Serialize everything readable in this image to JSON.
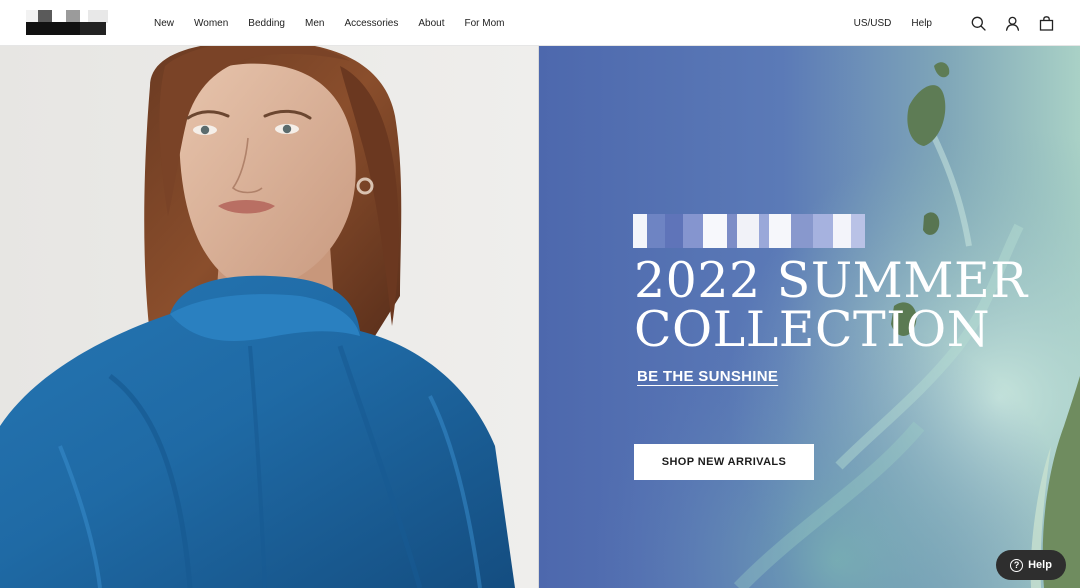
{
  "header": {
    "nav": [
      "New",
      "Women",
      "Bedding",
      "Men",
      "Accessories",
      "About",
      "For Mom"
    ],
    "region": "US/USD",
    "help": "Help",
    "icons": [
      "search-icon",
      "account-icon",
      "cart-icon"
    ]
  },
  "hero": {
    "headline_line1": "2022 SUMMER",
    "headline_line2": "COLLECTION",
    "subhead": "BE THE SUNSHINE",
    "cta": "SHOP NEW ARRIVALS"
  },
  "help_widget": {
    "label": "Help",
    "icon": "?"
  },
  "colors": {
    "dress_blue": "#1f6aa5",
    "ocean_blue": "#5b7ab7",
    "help_bg": "#2e2e2e"
  }
}
